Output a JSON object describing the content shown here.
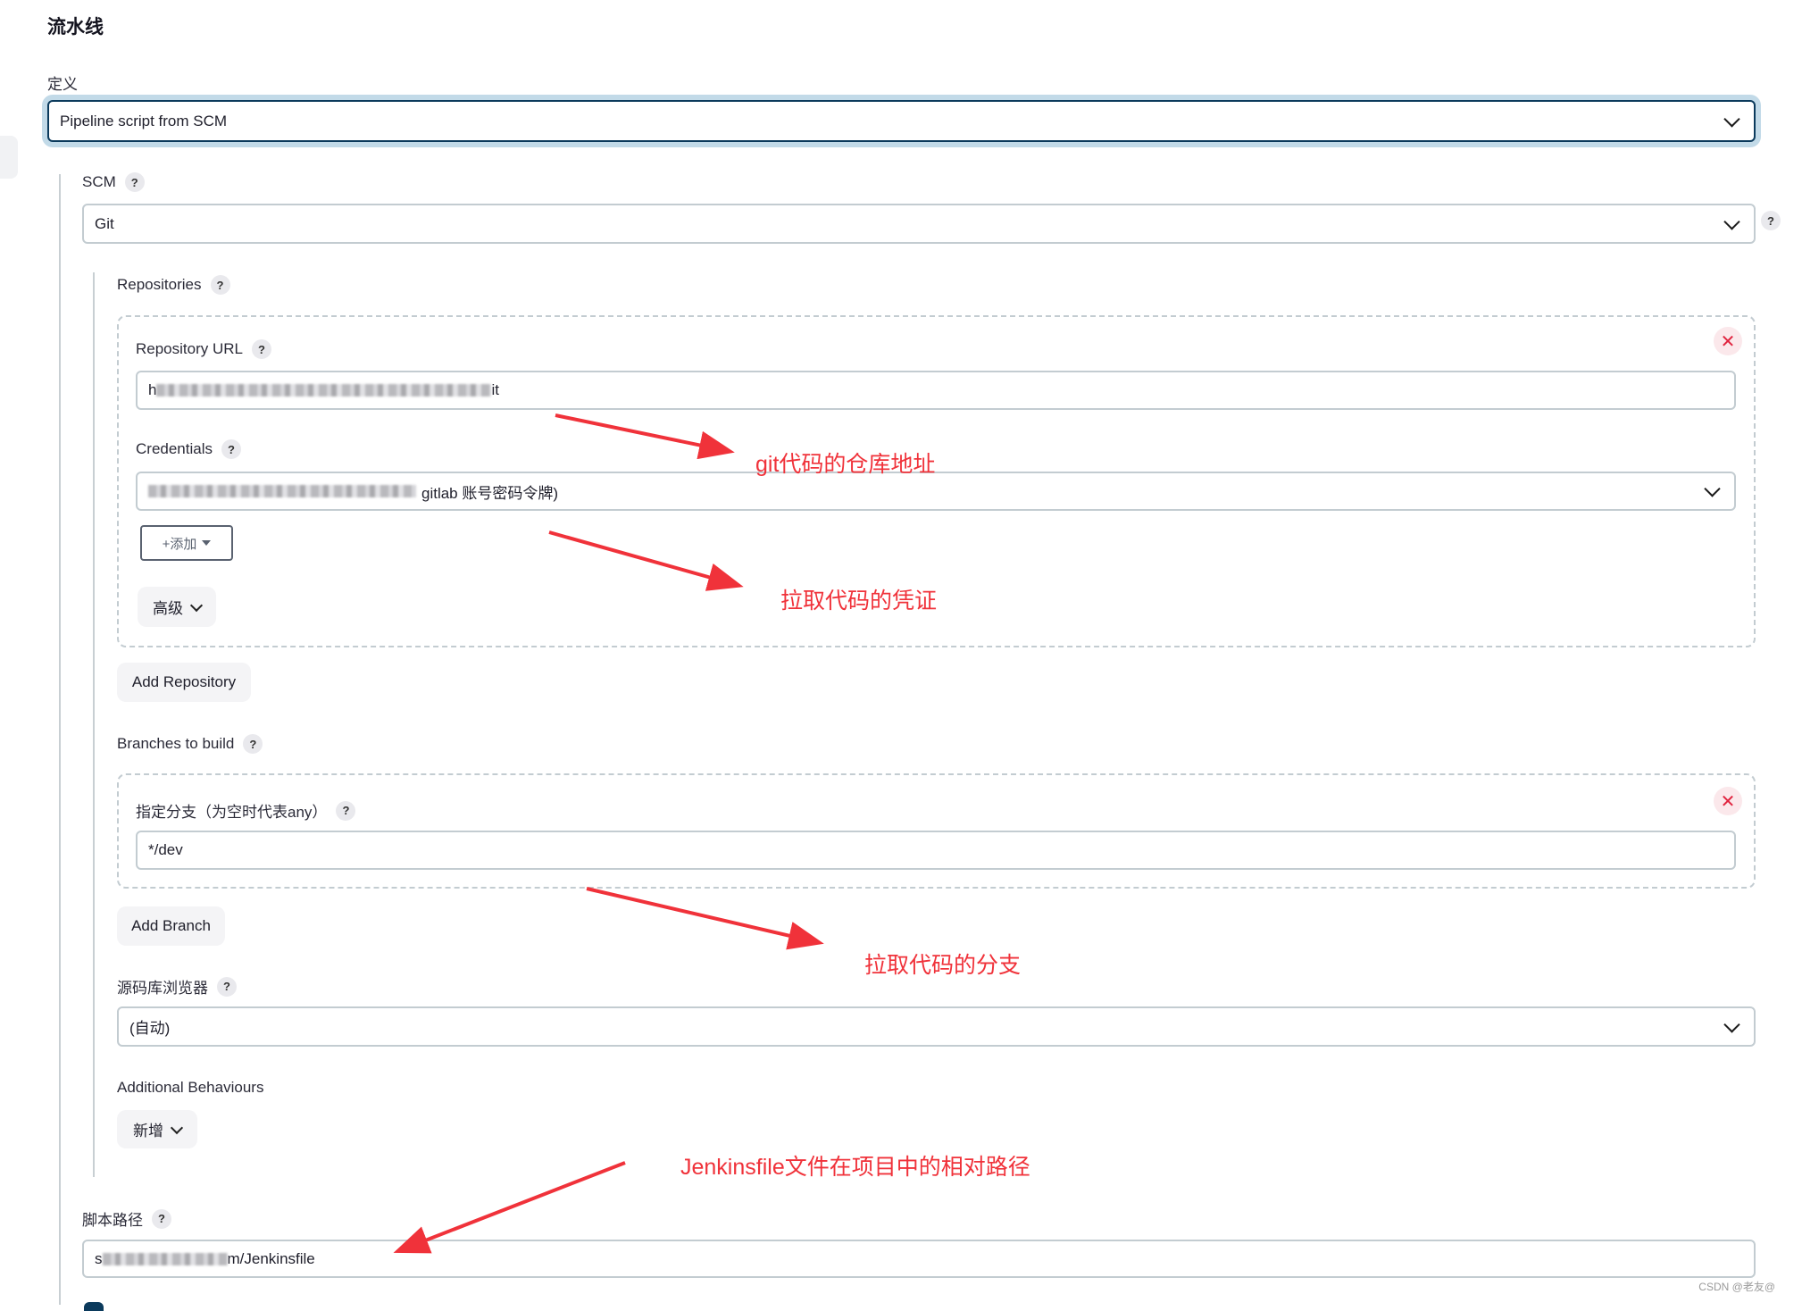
{
  "section": {
    "title": "流水线"
  },
  "definition": {
    "label": "定义",
    "value": "Pipeline script from SCM"
  },
  "scm": {
    "label": "SCM",
    "value": "Git"
  },
  "repositories": {
    "label": "Repositories",
    "url_label": "Repository URL",
    "url_prefix": "h",
    "url_suffix": "it",
    "credentials_label": "Credentials",
    "credentials_suffix": "gitlab 账号密码令牌)",
    "add_label": "+添加",
    "advanced_label": "高级",
    "add_repository_label": "Add Repository"
  },
  "branches": {
    "label": "Branches to build",
    "specifier_label": "指定分支（为空时代表any）",
    "specifier_value": "*/dev",
    "add_branch_label": "Add Branch"
  },
  "browser": {
    "label": "源码库浏览器",
    "value": "(自动)"
  },
  "behaviours": {
    "label": "Additional Behaviours",
    "add_label": "新增"
  },
  "script_path": {
    "label": "脚本路径",
    "value_prefix": "s",
    "value_suffix": "m/Jenkinsfile"
  },
  "annotations": {
    "repo_url": "git代码的仓库地址",
    "credentials": "拉取代码的凭证",
    "branch": "拉取代码的分支",
    "jenkinsfile": "Jenkinsfile文件在项目中的相对路径",
    "color": "#f0323a"
  },
  "watermark": "CSDN @老友@"
}
